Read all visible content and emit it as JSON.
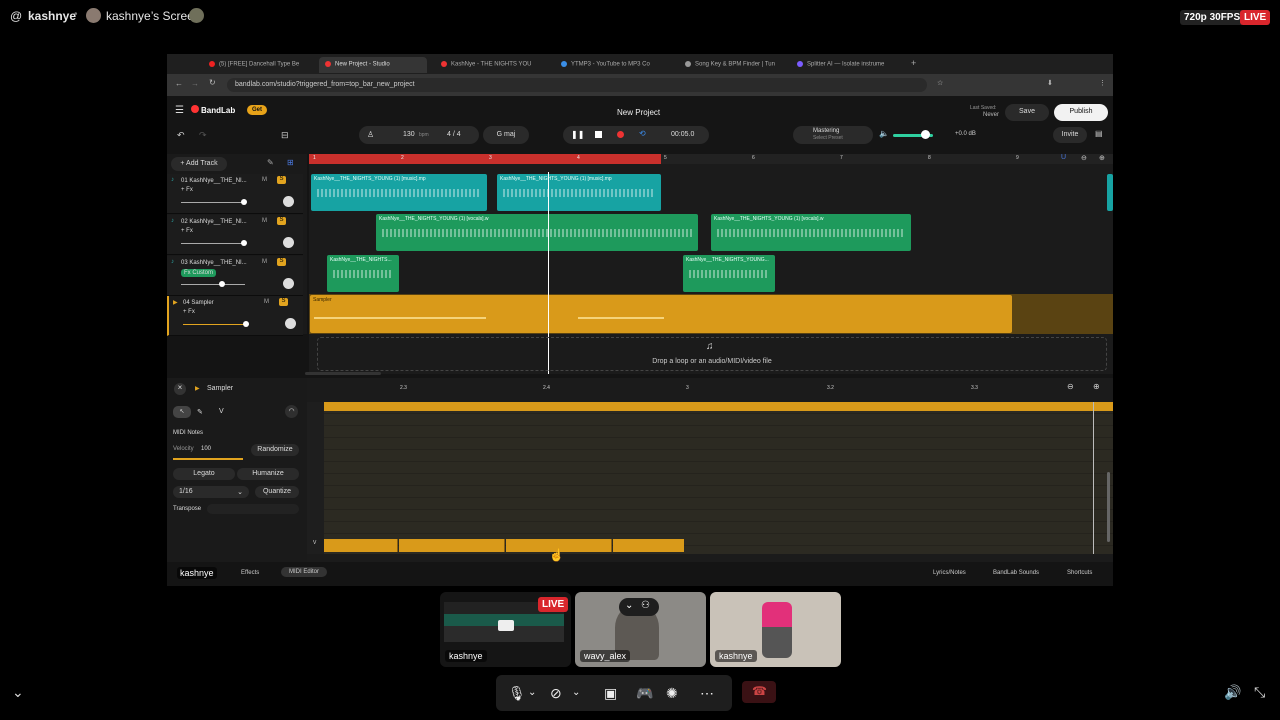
{
  "topbar": {
    "at_symbol": "@",
    "username": "kashnye",
    "screen_label": "kashnye’s Screen",
    "quality": "720p 30FPS",
    "live": "LIVE"
  },
  "browser": {
    "tabs": [
      {
        "label": "(5) [FREE] Dancehall Type Be",
        "color": "#e22"
      },
      {
        "label": "New Project - Studio",
        "color": "#e33"
      },
      {
        "label": "KashNye - THE NIGHTS YOU",
        "color": "#e33"
      },
      {
        "label": "YTMP3 - YouTube to MP3 Co",
        "color": "#3a8ee6"
      },
      {
        "label": "Song Key & BPM Finder | Tun",
        "color": "#999"
      },
      {
        "label": "Splitter AI — Isolate instrume",
        "color": "#7b5cff"
      }
    ],
    "url": "bandlab.com/studio?triggered_from=top_bar_new_project"
  },
  "bandlab": {
    "logo": "BandLab",
    "get_label": "Get",
    "project_title": "New Project",
    "last_saved_label": "Last Saved:",
    "last_saved_value": "Never",
    "save_label": "Save",
    "publish_label": "Publish",
    "bpm": "130",
    "bpm_unit": "bpm",
    "time_signature": "4 / 4",
    "key": "G maj",
    "time": "00:05.0",
    "mastering_label": "Mastering",
    "mastering_sub": "Select Preset",
    "volume_db": "+0.0 dB",
    "invite_label": "Invite",
    "add_track_label": "+ Add Track",
    "ruler": [
      "1",
      "2",
      "3",
      "4",
      "5",
      "6",
      "7",
      "8",
      "9"
    ],
    "drop_text": "Drop a loop or an audio/MIDI/video file"
  },
  "tracks": [
    {
      "name": "01  KashNye__THE_NI...",
      "fx": "+ Fx"
    },
    {
      "name": "02  KashNye__THE_NI...",
      "fx": "+ Fx"
    },
    {
      "name": "03  KashNye__THE_NI...",
      "fx": "Fx Custom"
    },
    {
      "name": "04  Sampler",
      "fx": "+ Fx"
    }
  ],
  "clips": {
    "t1a": "KashNye__THE_NIGHTS_YOUNG (1) [music].mp",
    "t1b": "KashNye__THE_NIGHTS_YOUNG (1) [music].mp",
    "t2a": "KashNye__THE_NIGHTS_YOUNG (1) [vocals].w",
    "t2b": "KashNye__THE_NIGHTS_YOUNG (1) [vocals].w",
    "t3a": "KashNye__THE_NIGHTS...",
    "t3b": "KashNye__THE_NIGHTS_YOUNG...",
    "t4": "Sampler"
  },
  "editor": {
    "title": "Sampler",
    "midi_notes": "MIDI Notes",
    "velocity_label": "Velocity",
    "velocity_value": "100",
    "randomize": "Randomize",
    "legato": "Legato",
    "humanize": "Humanize",
    "grid": "1/16",
    "quantize": "Quantize",
    "transpose": "Transpose",
    "ruler": [
      "2.3",
      "2.4",
      "3",
      "3.2",
      "3.3"
    ],
    "key_label": "V"
  },
  "bottom_tabs": {
    "owner": "kashnye",
    "effects": "Effects",
    "midi_editor": "MIDI Editor",
    "lyrics": "Lyrics/Notes",
    "sounds": "BandLab Sounds",
    "shortcuts": "Shortcuts"
  },
  "participants": [
    {
      "name": "kashnye",
      "live": "LIVE"
    },
    {
      "name": "wavy_alex"
    },
    {
      "name": "kashnye"
    }
  ]
}
